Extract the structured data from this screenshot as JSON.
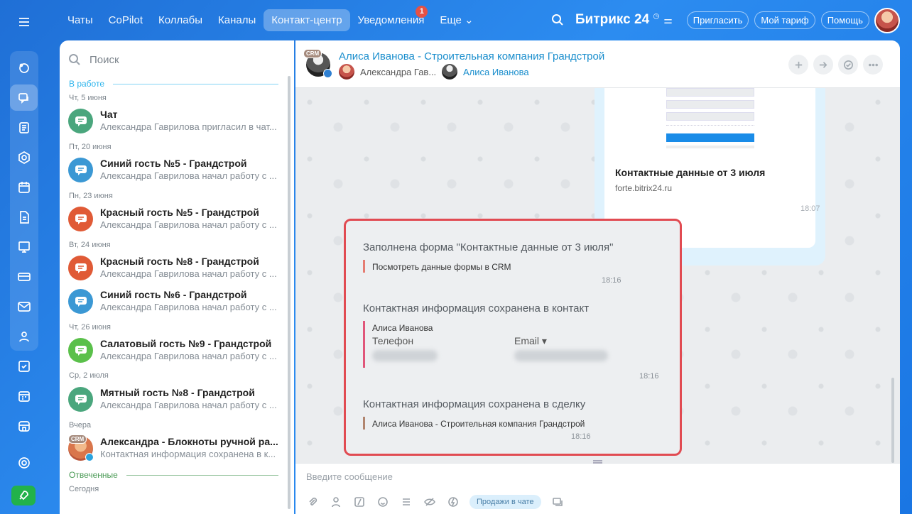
{
  "colors": {
    "accent": "#2fb5ec",
    "highlight_border": "#e14b52",
    "badge": "#f04f3c",
    "rocket": "#22b24a"
  },
  "topnav": {
    "items": [
      {
        "label": "Чаты"
      },
      {
        "label": "CoPilot"
      },
      {
        "label": "Коллабы"
      },
      {
        "label": "Каналы"
      },
      {
        "label": "Контакт-центр",
        "active": true
      },
      {
        "label": "Уведомления",
        "badge": "1"
      },
      {
        "label": "Еще ⌄"
      }
    ],
    "brand": "Битрикс",
    "brand_num": "24",
    "invite": "Пригласить",
    "tariff": "Мой тариф",
    "help": "Помощь"
  },
  "left": {
    "search_placeholder": "Поиск",
    "section_in_work": "В работе",
    "section_answered": "Отвеченные",
    "today": "Сегодня",
    "chats": [
      {
        "date": "Чт, 5 июня",
        "title": "Чат",
        "sub": "Александра Гаврилова пригласил в чат...",
        "color": "#4aa67d"
      },
      {
        "date": "Пт, 20 июня",
        "title": "Синий гость №5 - Грандстрой",
        "sub": "Александра Гаврилова начал работу с ...",
        "color": "#3b98d4"
      },
      {
        "date": "Пн, 23 июня",
        "title": "Красный гость №5 - Грандстрой",
        "sub": "Александра Гаврилова начал работу с ...",
        "color": "#e05a36"
      },
      {
        "date": "Вт, 24 июня",
        "title": "Красный гость №8 - Грандстрой",
        "sub": "Александра Гаврилова начал работу с ...",
        "color": "#e05a36"
      },
      {
        "date": "",
        "title": "Синий гость №6 - Грандстрой",
        "sub": "Александра Гаврилова начал работу с ...",
        "color": "#3b98d4"
      },
      {
        "date": "Чт, 26 июня",
        "title": "Салатовый гость №9 - Грандстрой",
        "sub": "Александра Гаврилова начал работу с ...",
        "color": "#5ac04a"
      },
      {
        "date": "Ср, 2 июля",
        "title": "Мятный гость №8 - Грандстрой",
        "sub": "Александра Гаврилова начал работу с ...",
        "color": "#4aa67d"
      },
      {
        "date": "Вчера",
        "title": "Александра - Блокноты ручной ра...",
        "sub": "Контактная информация сохранена в к...",
        "color": "#c6544b"
      }
    ]
  },
  "chat": {
    "title": "Алиса Иванова - Строительная компания Грандстрой",
    "member1": "Александра Гав...",
    "member2": "Алиса Иванова",
    "crm_tag": "CRM",
    "card_title": "Контактные данные от 3 июля",
    "card_link": "forte.bitrix24.ru",
    "card_time": "18:07",
    "sys": {
      "form_head": "Заполнена форма \"Контактные данные от 3 июля\"",
      "form_link": "Посмотреть данные формы в CRM",
      "time1": "18:16",
      "contact_head": "Контактная информация сохранена в контакт",
      "contact_name": "Алиса Иванова",
      "phone_label": "Телефон",
      "email_label": "Email ▾",
      "time2": "18:16",
      "deal_head": "Контактная информация сохранена в сделку",
      "deal_text": "Алиса Иванова - Строительная компания Грандстрой",
      "time3": "18:16"
    },
    "composer_placeholder": "Введите сообщение",
    "sales_label": "Продажи в чате"
  }
}
